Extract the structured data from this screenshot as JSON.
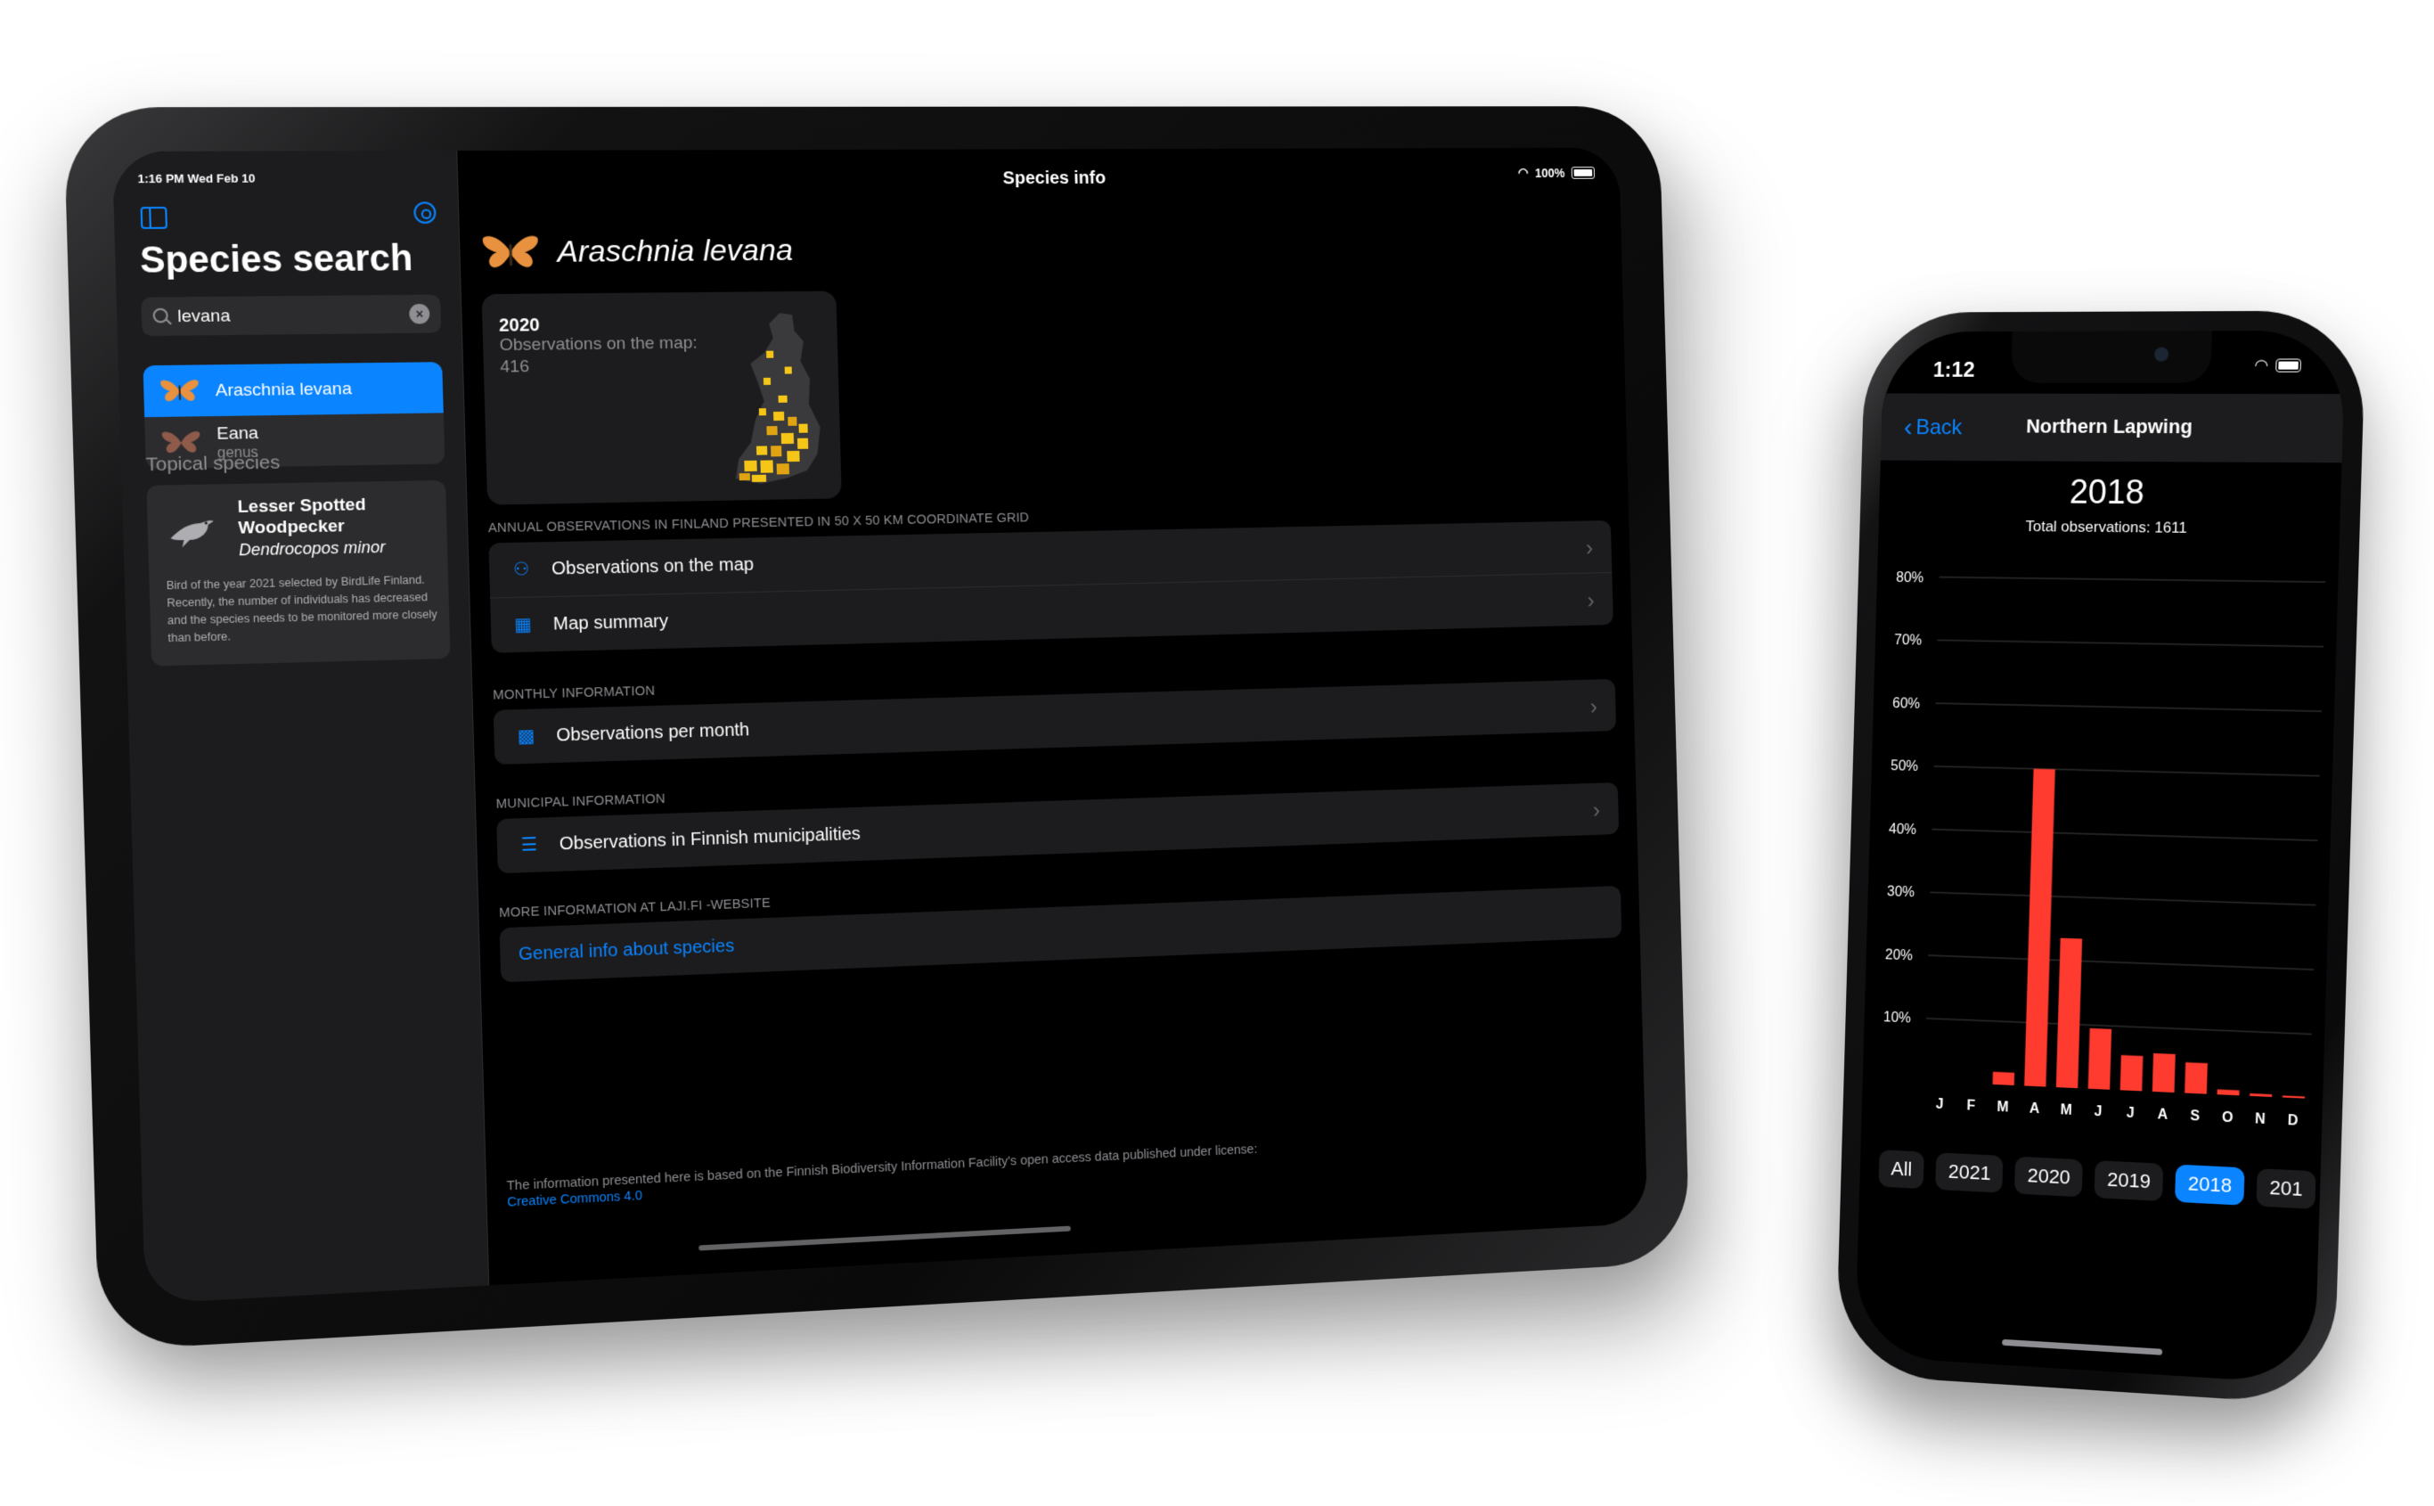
{
  "ipad": {
    "status": {
      "time": "1:16 PM   Wed Feb 10",
      "battery": "100%"
    },
    "sidebar": {
      "title": "Species search",
      "search": {
        "value": "levana"
      },
      "results": [
        {
          "name": "Araschnia levana",
          "sub": "",
          "selected": true
        },
        {
          "name": "Eana",
          "sub": "genus",
          "selected": false
        }
      ],
      "topical_header": "Topical species",
      "topical": {
        "common_name": "Lesser Spotted Woodpecker",
        "latin_name": "Dendrocopos minor",
        "description": "Bird of the year 2021 selected by BirdLife Finland. Recently, the number of individuals has decreased and the species needs to be monitored more closely than before."
      }
    },
    "detail": {
      "nav_title": "Species info",
      "species_name": "Araschnia levana",
      "map_card": {
        "year": "2020",
        "label": "Observations on the map:",
        "count": "416"
      },
      "sections": [
        {
          "header": "ANNUAL OBSERVATIONS IN FINLAND PRESENTED IN 50 X 50 KM COORDINATE GRID",
          "rows": [
            {
              "icon": "map-pin-icon",
              "label": "Observations on the map"
            },
            {
              "icon": "grid-icon",
              "label": "Map summary"
            }
          ]
        },
        {
          "header": "MONTHLY INFORMATION",
          "rows": [
            {
              "icon": "bar-chart-icon",
              "label": "Observations per month"
            }
          ]
        },
        {
          "header": "MUNICIPAL INFORMATION",
          "rows": [
            {
              "icon": "list-icon",
              "label": "Observations in Finnish municipalities"
            }
          ]
        },
        {
          "header": "MORE INFORMATION AT LAJI.FI -WEBSITE",
          "rows": [
            {
              "label": "General info about species"
            }
          ]
        }
      ],
      "footnote": "The information presented here is based on the Finnish Biodiversity Information Facility's open access data published under license:",
      "license": "Creative Commons 4.0"
    },
    "colors": {
      "accent": "#0a84ff",
      "butterfly": "#e8913f",
      "map_high": "#f5c518",
      "map_land": "#3a3a3c"
    }
  },
  "iphone": {
    "status": {
      "time": "1:12"
    },
    "nav": {
      "back": "Back",
      "title": "Northern Lapwing"
    },
    "year": "2018",
    "total": "Total observations: 1611",
    "segments": [
      "All",
      "2021",
      "2020",
      "2019",
      "2018",
      "201"
    ],
    "active_segment": "2018",
    "chart_data": {
      "type": "bar",
      "categories": [
        "J",
        "F",
        "M",
        "A",
        "M",
        "J",
        "J",
        "A",
        "S",
        "O",
        "N",
        "D"
      ],
      "values": [
        0,
        0,
        2,
        50,
        23.5,
        9.5,
        5.5,
        6,
        4.8,
        0.8,
        0.4,
        0.3
      ],
      "yticks": [
        "10%",
        "20%",
        "30%",
        "40%",
        "50%",
        "60%",
        "70%",
        "80%"
      ],
      "ylim": [
        0,
        80
      ],
      "bar_color": "#ff3b30",
      "grid": true
    }
  }
}
